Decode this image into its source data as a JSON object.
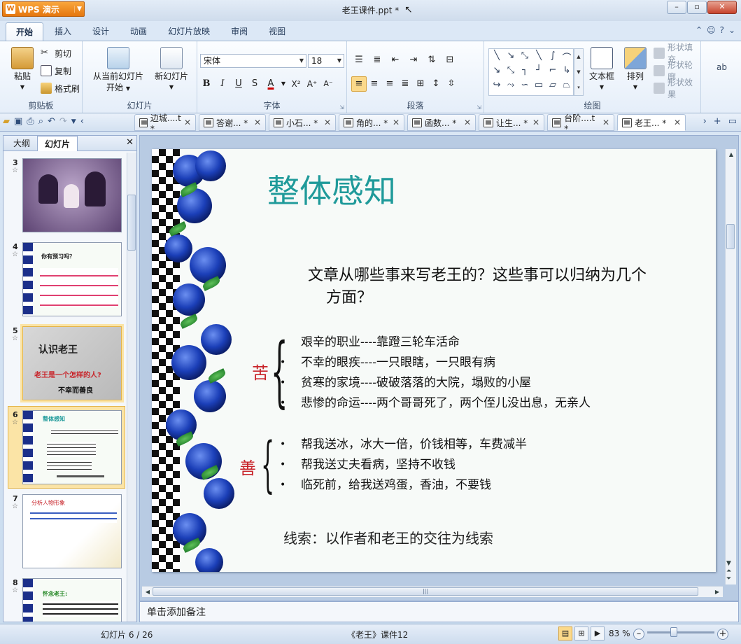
{
  "app": {
    "menu_button": "WPS 演示",
    "logo_glyph": "W",
    "window_title": "老王课件.ppt *"
  },
  "ribbon_tabs": [
    "开始",
    "插入",
    "设计",
    "动画",
    "幻灯片放映",
    "审阅",
    "视图"
  ],
  "ribbon": {
    "clipboard": {
      "paste": "粘贴",
      "cut": "剪切",
      "copy": "复制",
      "format_painter": "格式刷",
      "group": "剪贴板"
    },
    "slides": {
      "from_current": "从当前幻灯片",
      "start": "开始",
      "new_slide": "新幻灯片",
      "group": "幻灯片"
    },
    "font": {
      "family": "宋体",
      "size": "18",
      "bold": "B",
      "italic": "I",
      "underline": "U",
      "shadow": "S",
      "color": "A",
      "superscript": "X²",
      "grow": "A⁺",
      "shrink": "A⁻",
      "group": "字体"
    },
    "paragraph": {
      "group": "段落"
    },
    "drawing": {
      "textbox": "文本框",
      "arrange": "排列",
      "fill": "形状填充",
      "outline": "形状轮廓",
      "effect": "形状效果",
      "group": "绘图"
    }
  },
  "doc_tabs": [
    {
      "label": "边城....t *",
      "active": false
    },
    {
      "label": "答谢... *",
      "active": false
    },
    {
      "label": "小石... *",
      "active": false
    },
    {
      "label": "角的... *",
      "active": false
    },
    {
      "label": "函数... *",
      "active": false
    },
    {
      "label": "让生... *",
      "active": false
    },
    {
      "label": "台阶....t *",
      "active": false
    },
    {
      "label": "老王... *",
      "active": true
    }
  ],
  "left_panel": {
    "tab_outline": "大纲",
    "tab_slides": "幻灯片",
    "thumbnails": [
      {
        "number": "3",
        "title": ""
      },
      {
        "number": "4",
        "title": "你有预习吗？"
      },
      {
        "number": "5",
        "title": "认识老王",
        "subtitle": "老王是一个怎样的人?",
        "subtitle2": "不幸而善良"
      },
      {
        "number": "6",
        "title": "整体感知",
        "selected": true
      },
      {
        "number": "7",
        "title": "分析人物形象"
      },
      {
        "number": "8",
        "title": "怀念老王:"
      }
    ]
  },
  "slide": {
    "title": "整体感知",
    "question_line1": "文章从哪些事来写老王的？这些事可以归纳为几个",
    "question_line2": "方面？",
    "group_bitter_label": "苦",
    "bitter_items": [
      "艰辛的职业----靠蹬三轮车活命",
      "不幸的眼疾----一只眼瞎，一只眼有病",
      "贫寒的家境----破破落落的大院，塌败的小屋",
      "悲惨的命运----两个哥哥死了，两个侄儿没出息，无亲人"
    ],
    "group_kind_label": "善",
    "kind_items": [
      "帮我送冰，冰大一倍，价钱相等，车费减半",
      "帮我送丈夫看病，坚持不收钱",
      "临死前，给我送鸡蛋，香油，不要钱"
    ],
    "clue": "线索：以作者和老王的交往为线索"
  },
  "notes_placeholder": "单击添加备注",
  "status": {
    "slide_counter": "幻灯片 6 / 26",
    "doc_name": "《老王》课件12",
    "zoom": "83 %"
  },
  "colors": {
    "title_teal": "#1f9a9a",
    "category_red": "#c8242a",
    "accent_orange": "#e5760e"
  }
}
